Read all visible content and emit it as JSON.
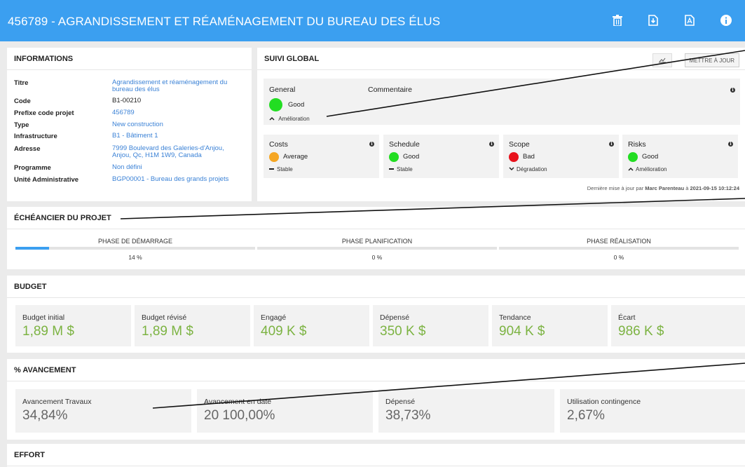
{
  "header": {
    "title": "456789 - AGRANDISSEMENT ET RÉAMÉNAGEMENT DU BUREAU DES ÉLUS"
  },
  "informations": {
    "title": "INFORMATIONS",
    "rows": [
      {
        "key": "Titre",
        "value": "Agrandissement et réaménagement du bureau des élus",
        "link": true
      },
      {
        "key": "Code",
        "value": "B1-00210",
        "link": false
      },
      {
        "key": "Prefixe code projet",
        "value": "456789",
        "link": true
      },
      {
        "key": "Type",
        "value": "New construction",
        "link": true
      },
      {
        "key": "Infrastructure",
        "value": "B1 - Bâtiment 1",
        "link": true
      },
      {
        "key": "Adresse",
        "value": "7999 Boulevard des Galeries-d'Anjou, Anjou, Qc, H1M 1W9, Canada",
        "link": true
      },
      {
        "key": "Programme",
        "value": "Non défini",
        "link": true
      },
      {
        "key": "Unité Administrative",
        "value": "BGP00001 - Bureau des grands projets",
        "link": true
      }
    ]
  },
  "suivi": {
    "title": "SUIVI GLOBAL",
    "update_label": "METTRE À JOUR",
    "general": {
      "label": "General",
      "comment_label": "Commentaire",
      "status": "Good",
      "trend": "Amélioration",
      "color": "#22dd22"
    },
    "indicators": [
      {
        "label": "Costs",
        "status": "Average",
        "trend": "Stable",
        "trend_icon": "dash",
        "color": "#f5a623"
      },
      {
        "label": "Schedule",
        "status": "Good",
        "trend": "Stable",
        "trend_icon": "dash",
        "color": "#22dd22"
      },
      {
        "label": "Scope",
        "status": "Bad",
        "trend": "Dégradation",
        "trend_icon": "down",
        "color": "#e8121c"
      },
      {
        "label": "Risks",
        "status": "Good",
        "trend": "Amélioration",
        "trend_icon": "up",
        "color": "#22dd22"
      }
    ],
    "last_update_prefix": "Dernière mise à jour par",
    "last_update_user": "Marc Parenteau",
    "last_update_mid": "à",
    "last_update_date": "2021-09-15 10:12:24"
  },
  "echeancier": {
    "title": "ÉCHÉANCIER DU PROJET",
    "phases": [
      {
        "label": "PHASE DE DÉMARRAGE",
        "pct": "14 %",
        "progress": 0.14
      },
      {
        "label": "PHASE PLANIFICATION",
        "pct": "0 %",
        "progress": 0
      },
      {
        "label": "PHASE RÉALISATION",
        "pct": "0 %",
        "progress": 0
      }
    ]
  },
  "budget": {
    "title": "BUDGET",
    "items": [
      {
        "label": "Budget initial",
        "value": "1,89 M $"
      },
      {
        "label": "Budget révisé",
        "value": "1,89 M $"
      },
      {
        "label": "Engagé",
        "value": "409 K $"
      },
      {
        "label": "Dépensé",
        "value": "350 K $"
      },
      {
        "label": "Tendance",
        "value": "904 K $"
      },
      {
        "label": "Écart",
        "value": "986 K $"
      }
    ]
  },
  "avancement": {
    "title": "% AVANCEMENT",
    "items": [
      {
        "label": "Avancement Travaux",
        "value": "34,84%"
      },
      {
        "label": "Avancement en date",
        "value": "20 100,00%"
      },
      {
        "label": "Dépensé",
        "value": "38,73%"
      },
      {
        "label": "Utilisation contingence",
        "value": "2,67%"
      }
    ]
  },
  "effort": {
    "title": "EFFORT"
  },
  "colors": {
    "topbar": "#3b9ff0",
    "link": "#3b82d6",
    "metric_value": "#7cb342"
  }
}
